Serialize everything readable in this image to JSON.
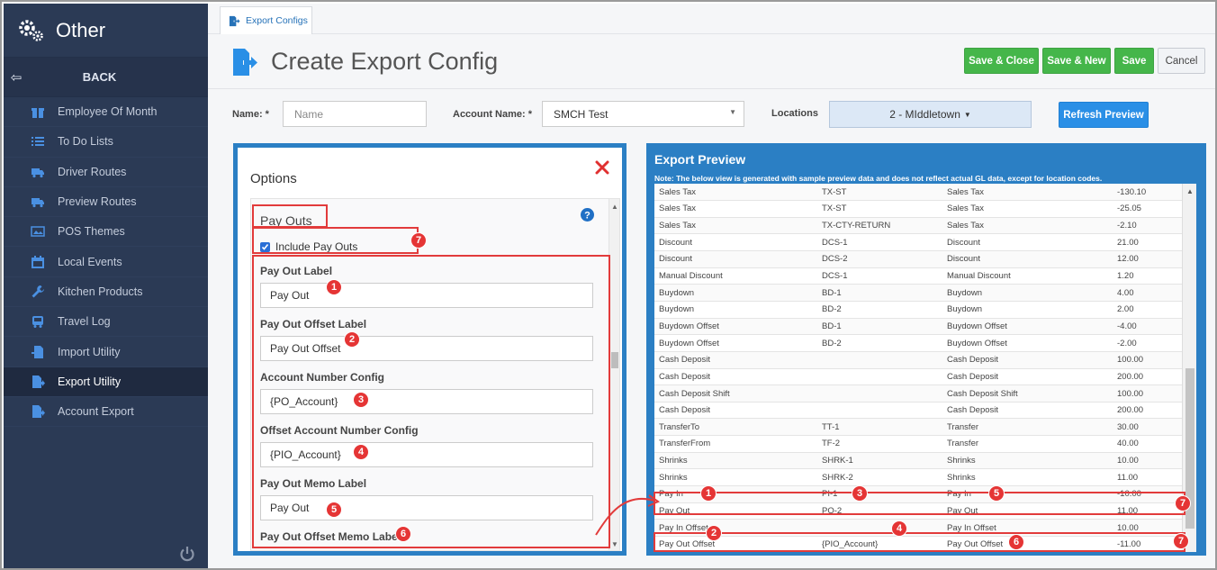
{
  "sidebar": {
    "title": "Other",
    "back_label": "BACK",
    "items": [
      {
        "label": "Employee Of Month",
        "icon": "gift-icon",
        "active": false
      },
      {
        "label": "To Do Lists",
        "icon": "list-icon",
        "active": false
      },
      {
        "label": "Driver Routes",
        "icon": "truck-icon",
        "active": false
      },
      {
        "label": "Preview Routes",
        "icon": "truck-icon",
        "active": false
      },
      {
        "label": "POS Themes",
        "icon": "image-icon",
        "active": false
      },
      {
        "label": "Local Events",
        "icon": "calendar-icon",
        "active": false
      },
      {
        "label": "Kitchen Products",
        "icon": "wrench-icon",
        "active": false
      },
      {
        "label": "Travel Log",
        "icon": "bus-icon",
        "active": false
      },
      {
        "label": "Import Utility",
        "icon": "file-import-icon",
        "active": false
      },
      {
        "label": "Export Utility",
        "icon": "file-export-icon",
        "active": true
      },
      {
        "label": "Account Export",
        "icon": "file-export-icon",
        "active": false
      }
    ]
  },
  "tabs": [
    {
      "label": "Export Configs",
      "icon": "file-export-icon"
    }
  ],
  "page": {
    "title": "Create Export Config"
  },
  "toolbar": {
    "save_close_label": "Save & Close",
    "save_new_label": "Save & New",
    "save_label": "Save",
    "cancel_label": "Cancel"
  },
  "form": {
    "name_label": "Name: *",
    "name_placeholder": "Name",
    "account_label": "Account Name: *",
    "account_value": "SMCH Test",
    "locations_label": "Locations",
    "locations_value": "2 - MIddletown",
    "refresh_label": "Refresh Preview"
  },
  "options": {
    "title": "Options",
    "section_title": "Pay Outs",
    "include_label": "Include Pay Outs",
    "include_checked": true,
    "fields": [
      {
        "label": "Pay Out Label",
        "value": "Pay Out"
      },
      {
        "label": "Pay Out Offset Label",
        "value": "Pay Out Offset"
      },
      {
        "label": "Account Number Config",
        "value": "{PO_Account}"
      },
      {
        "label": "Offset Account Number Config",
        "value": "{PIO_Account}"
      },
      {
        "label": "Pay Out Memo Label",
        "value": "Pay Out"
      },
      {
        "label": "Pay Out Offset Memo Label",
        "value": ""
      }
    ]
  },
  "preview": {
    "title": "Export Preview",
    "note_prefix": "Note",
    "note": ": The below view is generated with sample preview data and does not reflect actual GL data, except for location codes.",
    "rows": [
      [
        "Sales Tax",
        "TX-ST",
        "Sales Tax",
        "-130.10"
      ],
      [
        "Sales Tax",
        "TX-ST",
        "Sales Tax",
        "-25.05"
      ],
      [
        "Sales Tax",
        "TX-CTY-RETURN",
        "Sales Tax",
        "-2.10"
      ],
      [
        "Discount",
        "DCS-1",
        "Discount",
        "21.00"
      ],
      [
        "Discount",
        "DCS-2",
        "Discount",
        "12.00"
      ],
      [
        "Manual Discount",
        "DCS-1",
        "Manual Discount",
        "1.20"
      ],
      [
        "Buydown",
        "BD-1",
        "Buydown",
        "4.00"
      ],
      [
        "Buydown",
        "BD-2",
        "Buydown",
        "2.00"
      ],
      [
        "Buydown Offset",
        "BD-1",
        "Buydown Offset",
        "-4.00"
      ],
      [
        "Buydown Offset",
        "BD-2",
        "Buydown Offset",
        "-2.00"
      ],
      [
        "Cash Deposit",
        "",
        "Cash Deposit",
        "100.00"
      ],
      [
        "Cash Deposit",
        "",
        "Cash Deposit",
        "200.00"
      ],
      [
        "Cash Deposit Shift",
        "",
        "Cash Deposit Shift",
        "100.00"
      ],
      [
        "Cash Deposit",
        "",
        "Cash Deposit",
        "200.00"
      ],
      [
        "TransferTo",
        "TT-1",
        "Transfer",
        "30.00"
      ],
      [
        "TransferFrom",
        "TF-2",
        "Transfer",
        "40.00"
      ],
      [
        "Shrinks",
        "SHRK-1",
        "Shrinks",
        "10.00"
      ],
      [
        "Shrinks",
        "SHRK-2",
        "Shrinks",
        "11.00"
      ],
      [
        "Pay In",
        "PI-1",
        "Pay In",
        "-10.00"
      ],
      [
        "Pay Out",
        "PO-2",
        "Pay Out",
        "11.00"
      ],
      [
        "Pay In Offset",
        "",
        "Pay In Offset",
        "10.00"
      ],
      [
        "Pay Out Offset",
        "{PIO_Account}",
        "Pay Out Offset",
        "-11.00"
      ]
    ]
  },
  "markers": {
    "m1": "1",
    "m2": "2",
    "m3": "3",
    "m4": "4",
    "m5": "5",
    "m6": "6",
    "m7": "7"
  },
  "colors": {
    "sidebar_bg": "#2b3a55",
    "accent_blue": "#2b7fc4",
    "save_green": "#45b64a",
    "highlight_red": "#e23b3b"
  }
}
